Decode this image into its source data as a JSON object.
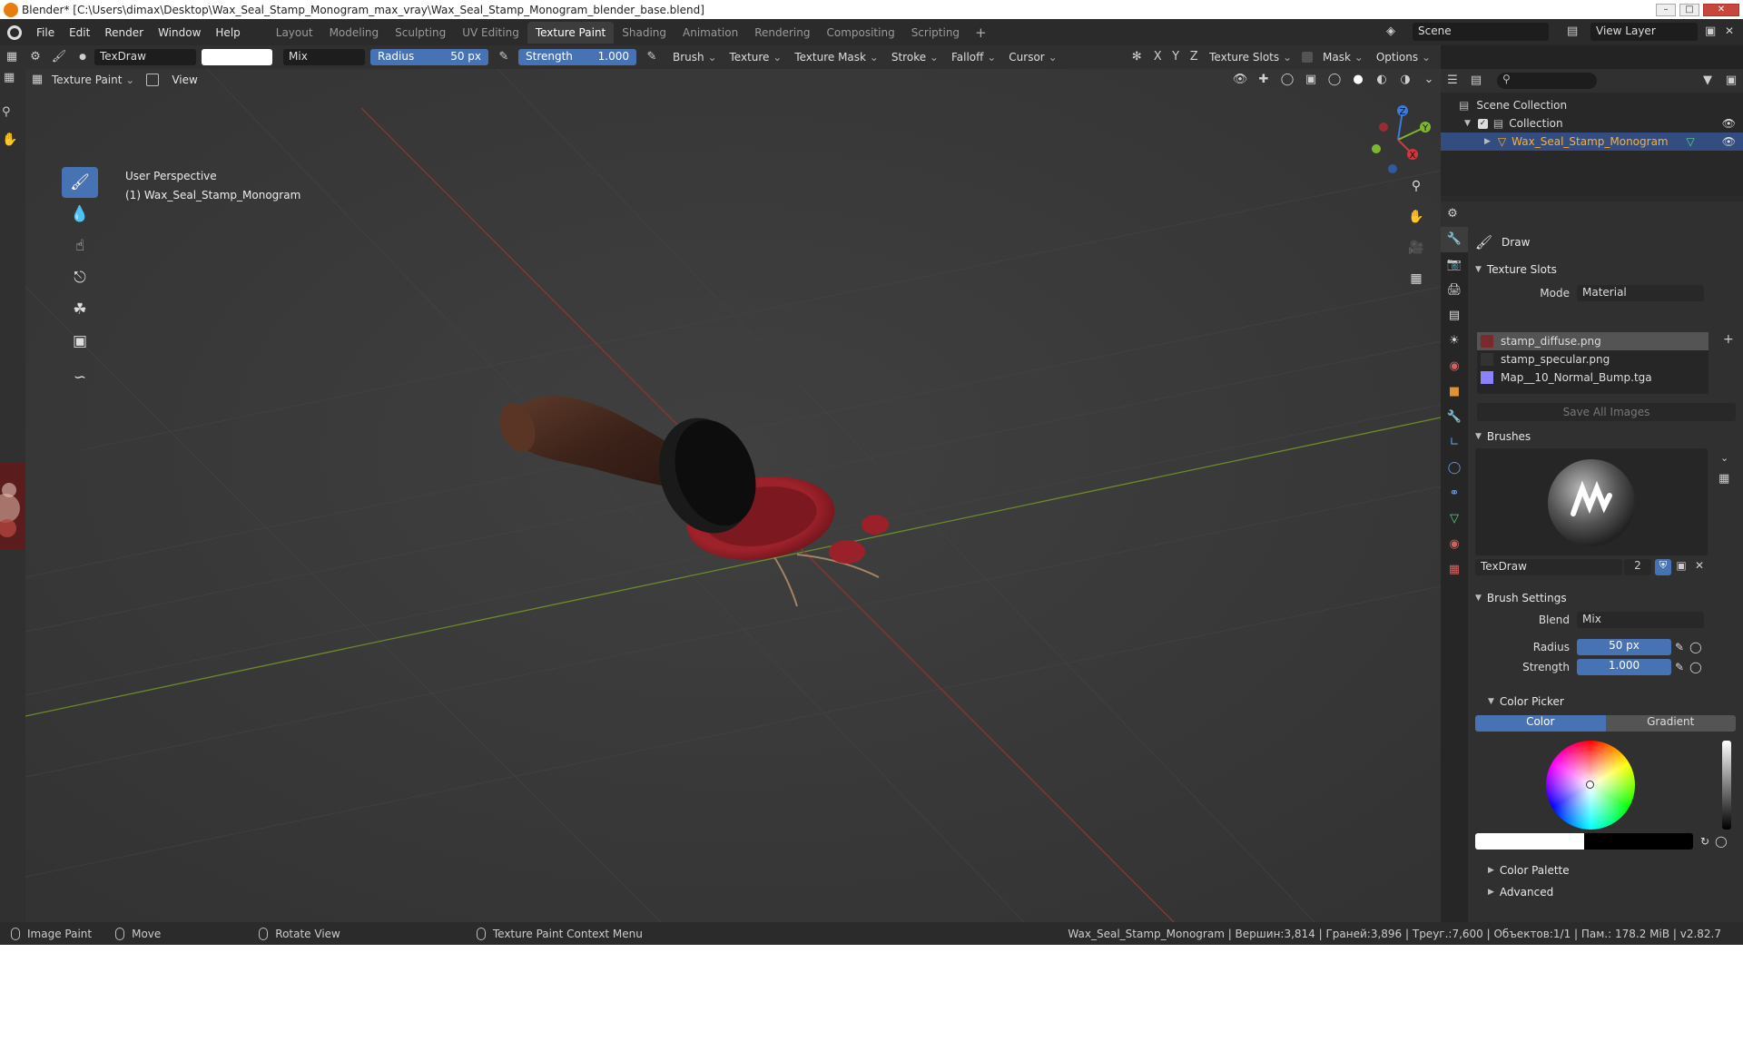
{
  "window": {
    "title": "Blender* [C:\\Users\\dimax\\Desktop\\Wax_Seal_Stamp_Monogram_max_vray\\Wax_Seal_Stamp_Monogram_blender_base.blend]",
    "minimize": "–",
    "maximize": "□",
    "close": "✕"
  },
  "menu": [
    "File",
    "Edit",
    "Render",
    "Window",
    "Help"
  ],
  "workspaces": [
    "Layout",
    "Modeling",
    "Sculpting",
    "UV Editing",
    "Texture Paint",
    "Shading",
    "Animation",
    "Rendering",
    "Compositing",
    "Scripting"
  ],
  "active_workspace": "Texture Paint",
  "scene": {
    "scene_name": "Scene",
    "view_layer": "View Layer"
  },
  "tool_header": {
    "brush_name": "TexDraw",
    "blend": "Mix",
    "radius_label": "Radius",
    "radius_value": "50 px",
    "strength_label": "Strength",
    "strength_value": "1.000",
    "menus": [
      "Brush",
      "Texture",
      "Texture Mask",
      "Stroke",
      "Falloff",
      "Cursor"
    ],
    "axes": [
      "X",
      "Y",
      "Z"
    ],
    "right_menus": [
      "Texture Slots",
      "Mask",
      "Options"
    ],
    "color_swatch": "#ffffff"
  },
  "viewport_header": {
    "mode": "Texture Paint",
    "view_menu": "View"
  },
  "viewport": {
    "perspective": "User Perspective",
    "object_label": "(1) Wax_Seal_Stamp_Monogram",
    "gizmo_axes": [
      "Z",
      "Y",
      "X"
    ]
  },
  "outliner": {
    "root": "Scene Collection",
    "collection": "Collection",
    "object": "Wax_Seal_Stamp_Monogram"
  },
  "properties": {
    "tool_name": "Draw",
    "texture_slots": {
      "title": "Texture Slots",
      "mode_label": "Mode",
      "mode_value": "Material",
      "slots": [
        {
          "name": "stamp_diffuse.png",
          "color": "#7a2a2a"
        },
        {
          "name": "stamp_specular.png",
          "color": "#333333"
        },
        {
          "name": "Map__10_Normal_Bump.tga",
          "color": "#8c82ff"
        }
      ],
      "save_button": "Save All Images"
    },
    "brushes": {
      "title": "Brushes",
      "brush_name": "TexDraw",
      "users": "2"
    },
    "brush_settings": {
      "title": "Brush Settings",
      "blend_label": "Blend",
      "blend_value": "Mix",
      "radius_label": "Radius",
      "radius_value": "50 px",
      "strength_label": "Strength",
      "strength_value": "1.000"
    },
    "color_picker": {
      "title": "Color Picker",
      "tab_color": "Color",
      "tab_gradient": "Gradient",
      "primary": "#ffffff",
      "secondary": "#000000"
    },
    "color_palette": "Color Palette",
    "advanced": "Advanced"
  },
  "statusbar": {
    "items": [
      "Image Paint",
      "Move",
      "Rotate View",
      "Texture Paint Context Menu"
    ],
    "stats": "Wax_Seal_Stamp_Monogram | Вершин:3,814 | Граней:3,896 | Треуг.:7,600 | Объектов:1/1 | Пам.: 178.2 MiB | v2.82.7"
  }
}
